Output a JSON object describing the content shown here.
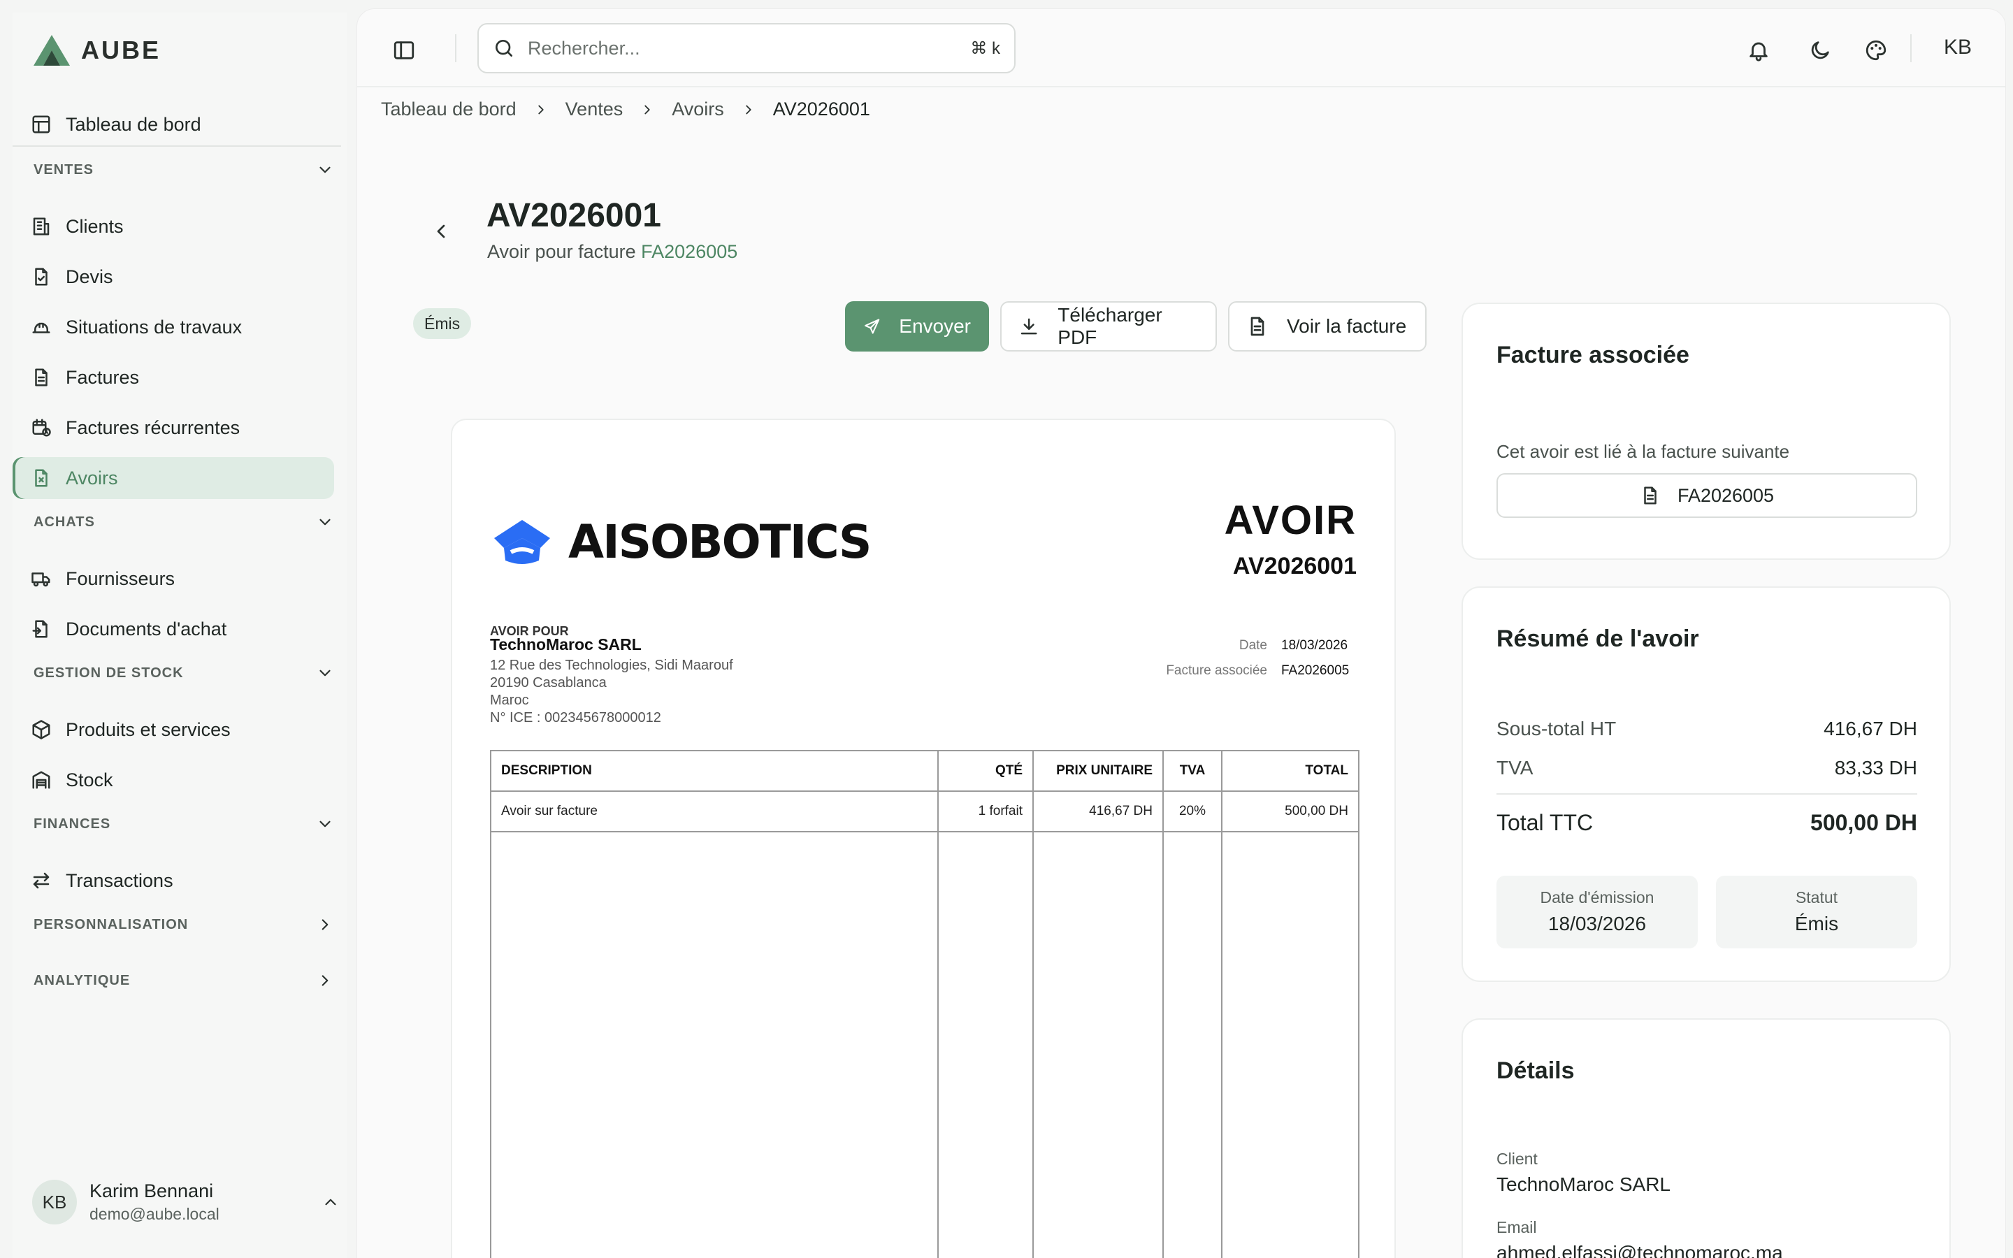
{
  "brand": {
    "name": "AUBE",
    "accent": "#5b9470"
  },
  "sidebar": {
    "dashboard": "Tableau de bord",
    "sections": {
      "ventes": "VENTES",
      "achats": "ACHATS",
      "stock": "GESTION DE STOCK",
      "finances": "FINANCES",
      "perso": "PERSONNALISATION",
      "analytique": "ANALYTIQUE"
    },
    "ventes_items": [
      "Clients",
      "Devis",
      "Situations de travaux",
      "Factures",
      "Factures récurrentes",
      "Avoirs"
    ],
    "achats_items": [
      "Fournisseurs",
      "Documents d'achat"
    ],
    "stock_items": [
      "Produits et services",
      "Stock"
    ],
    "finances_items": [
      "Transactions"
    ],
    "active_item": "Avoirs",
    "user": {
      "initials": "KB",
      "name": "Karim Bennani",
      "email": "demo@aube.local"
    }
  },
  "topbar": {
    "search_placeholder": "Rechercher...",
    "shortcut": "⌘ k",
    "user_initials": "KB"
  },
  "breadcrumb": [
    "Tableau de bord",
    "Ventes",
    "Avoirs",
    "AV2026001"
  ],
  "header": {
    "title": "AV2026001",
    "subtitle_prefix": "Avoir pour facture",
    "invoice_link": "FA2026005",
    "status_badge": "Émis"
  },
  "actions": {
    "send": "Envoyer",
    "download": "Télécharger PDF",
    "view_invoice": "Voir la facture"
  },
  "document": {
    "company": "AISOBOTICS",
    "type": "AVOIR",
    "number": "AV2026001",
    "recipient_label": "AVOIR POUR",
    "client_name": "TechnoMaroc SARL",
    "client_address": [
      "12 Rue des Technologies, Sidi Maarouf",
      "20190 Casablanca",
      "Maroc",
      "N° ICE : 002345678000012"
    ],
    "meta": [
      {
        "label": "Date",
        "value": "18/03/2026"
      },
      {
        "label": "Facture associée",
        "value": "FA2026005"
      }
    ],
    "columns": [
      "DESCRIPTION",
      "QTÉ",
      "PRIX UNITAIRE",
      "TVA",
      "TOTAL"
    ],
    "rows": [
      {
        "description": "Avoir sur facture",
        "qty": "1 forfait",
        "unit_price": "416,67 DH",
        "vat": "20%",
        "total": "500,00 DH"
      }
    ]
  },
  "linked_invoice_card": {
    "title": "Facture associée",
    "text": "Cet avoir est lié à la facture suivante",
    "invoice": "FA2026005"
  },
  "summary_card": {
    "title": "Résumé de l'avoir",
    "subtotal_label": "Sous-total HT",
    "subtotal": "416,67 DH",
    "vat_label": "TVA",
    "vat": "83,33 DH",
    "total_label": "Total TTC",
    "total": "500,00 DH",
    "issue_date_label": "Date d'émission",
    "issue_date": "18/03/2026",
    "status_label": "Statut",
    "status": "Émis"
  },
  "details_card": {
    "title": "Détails",
    "client_label": "Client",
    "client": "TechnoMaroc SARL",
    "email_label": "Email",
    "email": "ahmed.elfassi@technomaroc.ma"
  }
}
